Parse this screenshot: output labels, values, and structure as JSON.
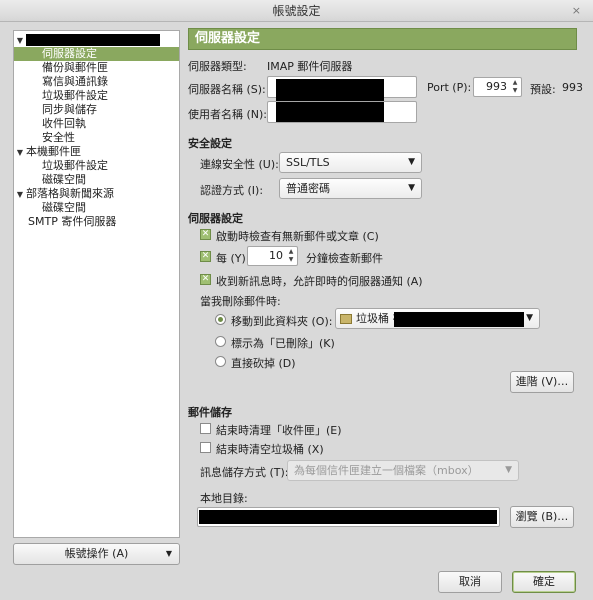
{
  "window": {
    "title": "帳號設定",
    "close": "×"
  },
  "sidebar": {
    "items": [
      {
        "label": "伺服器設定"
      },
      {
        "label": "備份與郵件匣"
      },
      {
        "label": "寫信與通訊錄"
      },
      {
        "label": "垃圾郵件設定"
      },
      {
        "label": "同步與儲存"
      },
      {
        "label": "收件回執"
      },
      {
        "label": "安全性"
      },
      {
        "label": "本機郵件匣"
      },
      {
        "label": "垃圾郵件設定"
      },
      {
        "label": "磁碟空間"
      },
      {
        "label": "部落格與新聞來源"
      },
      {
        "label": "磁碟空間"
      },
      {
        "label": "SMTP 寄件伺服器"
      }
    ],
    "account_actions": "帳號操作 (A)"
  },
  "panel": {
    "title": "伺服器設定",
    "server_type_label": "伺服器類型:",
    "server_type_value": "IMAP 郵件伺服器",
    "server_name_label": "伺服器名稱 (S):",
    "port_label": "Port (P):",
    "port_value": "993",
    "default_label": "預設:",
    "default_value": "993",
    "username_label": "使用者名稱 (N):",
    "security": {
      "heading": "安全設定",
      "conn_label": "連線安全性 (U):",
      "conn_value": "SSL/TLS",
      "auth_label": "認證方式 (I):",
      "auth_value": "普通密碼"
    },
    "server_settings": {
      "heading": "伺服器設定",
      "check_startup": "啟動時檢查有無新郵件或文章 (C)",
      "every_label": "每 (Y)",
      "every_value": "10",
      "every_suffix": "分鐘檢查新郵件",
      "push_notify": "收到新訊息時，允許即時的伺服器通知 (A)",
      "on_delete_label": "當我刪除郵件時:",
      "move_to_label": "移動到此資料夾 (O):",
      "move_to_folder": "垃圾桶 在",
      "mark_deleted_label": "標示為「已刪除」(K)",
      "delete_now_label": "直接砍掉 (D)",
      "advanced_button": "進階 (V)…"
    },
    "storage": {
      "heading": "郵件儲存",
      "clean_inbox": "結束時清理「收件匣」(E)",
      "empty_trash": "結束時清空垃圾桶 (X)",
      "store_type_label": "訊息儲存方式 (T):",
      "store_type_value": "為每個信件匣建立一個檔案（mbox）",
      "local_dir_label": "本地目錄:",
      "browse_button": "瀏覽 (B)…"
    },
    "cancel_button": "取消",
    "ok_button": "確定"
  }
}
